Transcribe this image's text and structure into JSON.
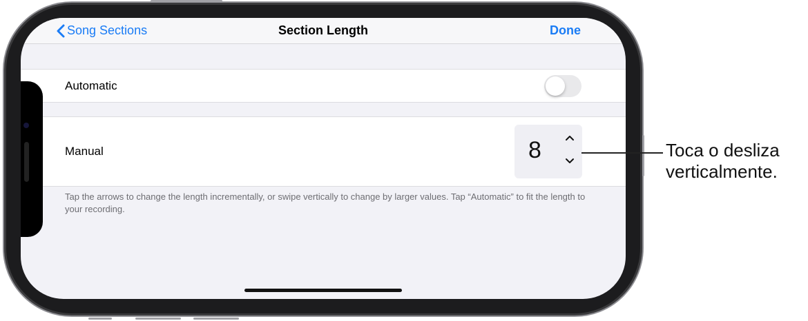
{
  "navbar": {
    "back_label": "Song Sections",
    "title": "Section Length",
    "done_label": "Done"
  },
  "automatic_row": {
    "label": "Automatic",
    "toggle_on": false
  },
  "manual_row": {
    "label": "Manual",
    "stepper_value": "8"
  },
  "footnote": "Tap the arrows to change the length incrementally, or swipe vertically to change by larger values. Tap “Automatic” to fit the length to your recording.",
  "callout": {
    "line1": "Toca o desliza",
    "line2": "verticalmente."
  },
  "colors": {
    "accent": "#1a7cf5",
    "background": "#f2f2f7",
    "toggle_off": "#e9e9eb"
  },
  "icons": {
    "back": "chevron-left-icon",
    "up": "chevron-up-icon",
    "down": "chevron-down-icon"
  }
}
